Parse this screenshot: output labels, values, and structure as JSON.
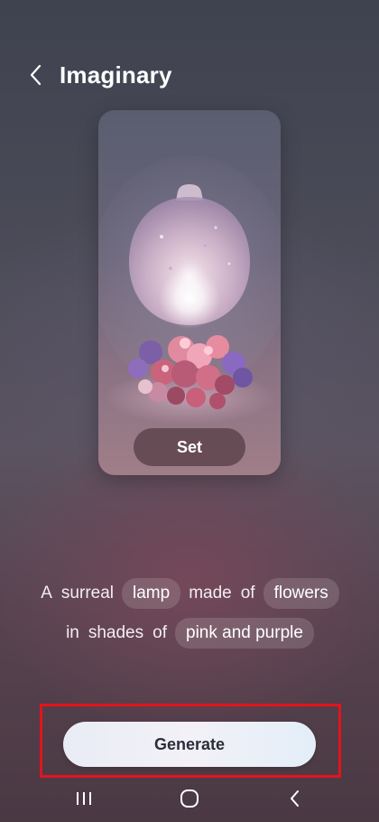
{
  "header": {
    "title": "Imaginary",
    "back_icon": "chevron-left-icon"
  },
  "preview": {
    "image_subject": "surreal lamp made of flowers",
    "set_label": "Set"
  },
  "prompt": {
    "line1": [
      {
        "text": "A",
        "chip": false
      },
      {
        "text": "surreal",
        "chip": false
      },
      {
        "text": "lamp",
        "chip": true
      },
      {
        "text": "made",
        "chip": false
      },
      {
        "text": "of",
        "chip": false
      },
      {
        "text": "flowers",
        "chip": true
      }
    ],
    "line2": [
      {
        "text": "in",
        "chip": false
      },
      {
        "text": "shades",
        "chip": false
      },
      {
        "text": "of",
        "chip": false
      },
      {
        "text": "pink and purple",
        "chip": true
      }
    ]
  },
  "generate": {
    "label": "Generate"
  },
  "nav": {
    "recents_icon": "recents-icon",
    "home_icon": "home-icon",
    "back_icon": "back-chevron-icon"
  },
  "colors": {
    "highlight": "#e3141c",
    "generate_bg": "#f1f1f7",
    "generate_text": "#2b2e3a",
    "chip_bg": "rgba(255,255,255,0.14)"
  }
}
